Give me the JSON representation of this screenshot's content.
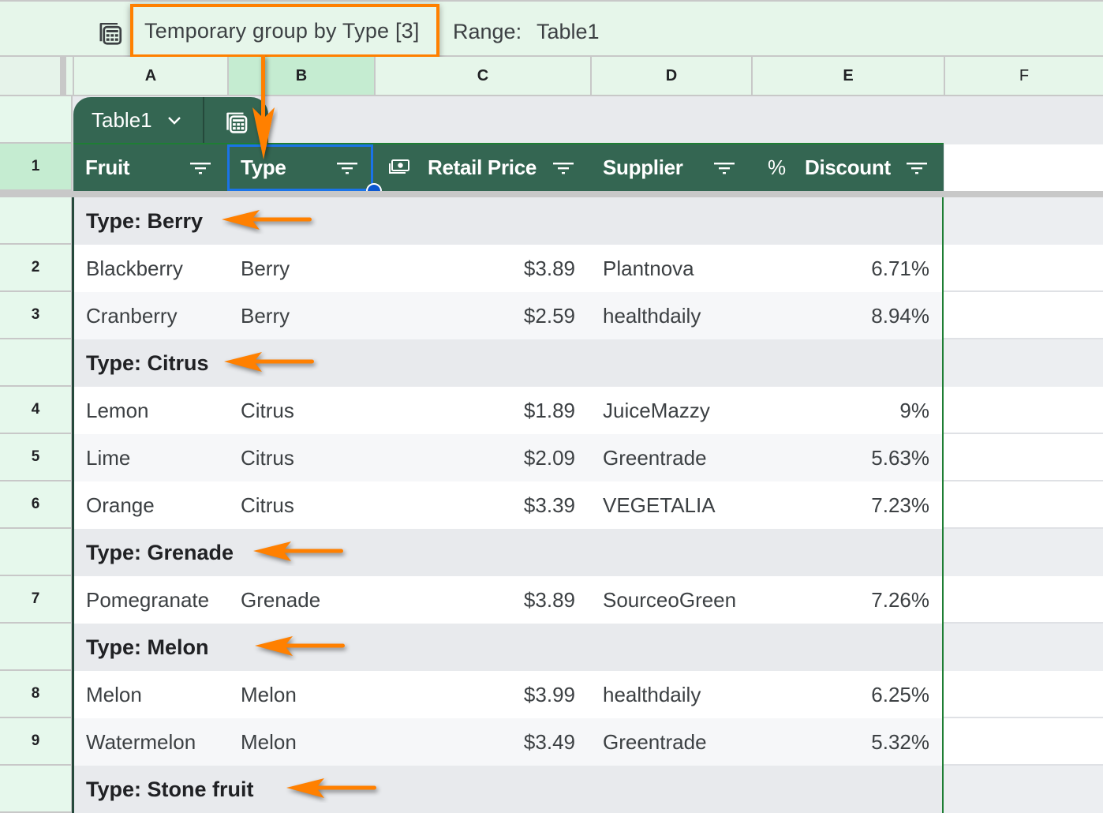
{
  "topbar": {
    "group_label": "Temporary group by Type [3]",
    "range_label": "Range:",
    "range_value": "Table1"
  },
  "columns": [
    "A",
    "B",
    "C",
    "D",
    "E",
    "F"
  ],
  "selected_column": "B",
  "table_tab": {
    "name": "Table1"
  },
  "header_row_number": "1",
  "headers": [
    {
      "label": "Fruit",
      "icon": null
    },
    {
      "label": "Type",
      "icon": null
    },
    {
      "label": "Retail Price",
      "icon": "money-icon"
    },
    {
      "label": "Supplier",
      "icon": null
    },
    {
      "label": "Discount",
      "icon": "percent-icon",
      "icon_glyph": "%"
    }
  ],
  "groups": [
    {
      "title": "Type: Berry",
      "rows": [
        {
          "row_number": "2",
          "fruit": "Blackberry",
          "type": "Berry",
          "price": "$3.89",
          "supplier": "Plantnova",
          "discount": "6.71%"
        },
        {
          "row_number": "3",
          "fruit": "Cranberry",
          "type": "Berry",
          "price": "$2.59",
          "supplier": "healthdaily",
          "discount": "8.94%"
        }
      ]
    },
    {
      "title": "Type: Citrus",
      "rows": [
        {
          "row_number": "4",
          "fruit": "Lemon",
          "type": "Citrus",
          "price": "$1.89",
          "supplier": "JuiceMazzy",
          "discount": "9%"
        },
        {
          "row_number": "5",
          "fruit": "Lime",
          "type": "Citrus",
          "price": "$2.09",
          "supplier": "Greentrade",
          "discount": "5.63%"
        },
        {
          "row_number": "6",
          "fruit": "Orange",
          "type": "Citrus",
          "price": "$3.39",
          "supplier": "VEGETALIA",
          "discount": "7.23%"
        }
      ]
    },
    {
      "title": "Type: Grenade",
      "rows": [
        {
          "row_number": "7",
          "fruit": "Pomegranate",
          "type": "Grenade",
          "price": "$3.89",
          "supplier": "SourceoGreen",
          "discount": "7.26%"
        }
      ]
    },
    {
      "title": "Type: Melon",
      "rows": [
        {
          "row_number": "8",
          "fruit": "Melon",
          "type": "Melon",
          "price": "$3.99",
          "supplier": "healthdaily",
          "discount": "6.25%"
        },
        {
          "row_number": "9",
          "fruit": "Watermelon",
          "type": "Melon",
          "price": "$3.49",
          "supplier": "Greentrade",
          "discount": "5.32%"
        }
      ]
    },
    {
      "title": "Type: Stone fruit",
      "rows": []
    }
  ],
  "colors": {
    "table_header": "#346652",
    "selection": "#1a73e8",
    "annotation": "#ff8000",
    "header_bg": "#e6f6ea",
    "selected_header_bg": "#c5ecd1"
  }
}
